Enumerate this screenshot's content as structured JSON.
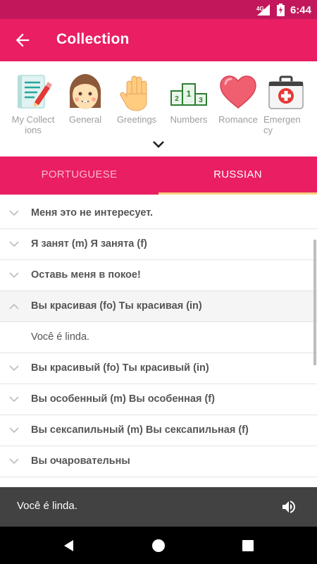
{
  "status_bar": {
    "network": "4G",
    "time": "6:44"
  },
  "app_bar": {
    "title": "Collection"
  },
  "categories": [
    {
      "label": "My Collect ions",
      "icon": "notepad-pencil-icon"
    },
    {
      "label": "General",
      "icon": "girl-face-icon"
    },
    {
      "label": "Greetings",
      "icon": "waving-hand-icon"
    },
    {
      "label": "Numbers",
      "icon": "podium-icon"
    },
    {
      "label": "Romance",
      "icon": "heart-icon"
    },
    {
      "label": "Emergen cy",
      "icon": "first-aid-kit-icon"
    }
  ],
  "tabs": [
    {
      "label": "PORTUGUESE",
      "selected": false
    },
    {
      "label": "RUSSIAN",
      "selected": true
    }
  ],
  "colors": {
    "primary": "#e91e63",
    "primary_dark": "#c2185b",
    "tab_indicator": "#ffd180",
    "player_bg": "#424242"
  },
  "phrases": [
    {
      "text": "Меня это не интересует.",
      "expanded": false
    },
    {
      "text": "Я занят (m)  Я занята (f)",
      "expanded": false
    },
    {
      "text": "Оставь меня в покое!",
      "expanded": false
    },
    {
      "text": "Вы красивая (fo)  Ты красивая (in)",
      "expanded": true
    },
    {
      "text": "Você é linda.",
      "translation": true
    },
    {
      "text": "Вы красивый (fo)  Ты красивый (in)",
      "expanded": false
    },
    {
      "text": "Вы особенный (m)  Вы особенная (f)",
      "expanded": false
    },
    {
      "text": "Вы сексапильный (m)  Вы сексапильная (f)",
      "expanded": false
    },
    {
      "text": "Вы очаровательны",
      "expanded": false
    }
  ],
  "player": {
    "text": "Você é linda."
  }
}
